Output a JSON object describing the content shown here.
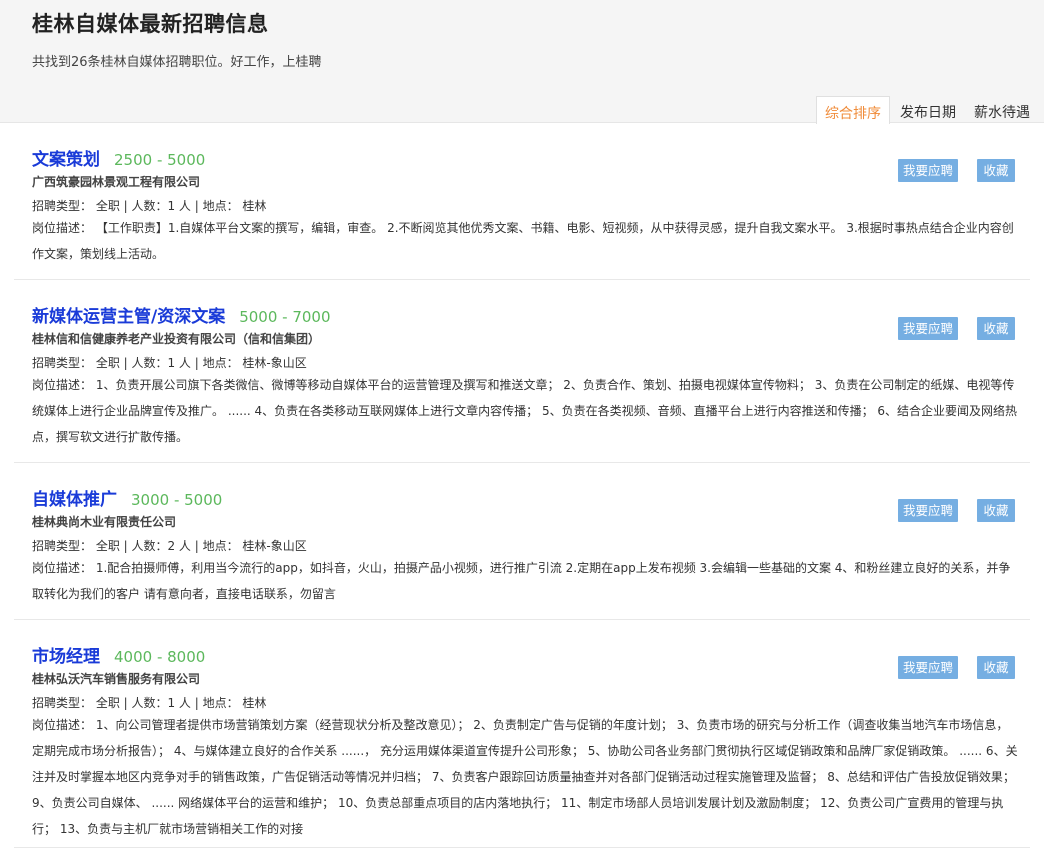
{
  "page": {
    "title": "桂林自媒体最新招聘信息",
    "summary": "共找到26条桂林自媒体招聘职位。好工作，上桂聘"
  },
  "sort_tabs": [
    {
      "label": "综合排序",
      "active": true
    },
    {
      "label": "发布日期",
      "active": false
    },
    {
      "label": "薪水待遇",
      "active": false
    }
  ],
  "buttons": {
    "apply": "我要应聘",
    "favorite": "收藏"
  },
  "jobs": [
    {
      "title": "文案策划",
      "salary": "2500 - 5000",
      "company": "广西筑豪园林景观工程有限公司",
      "meta": "招聘类型：  全职 | 人数：1 人 | 地点：  桂林",
      "description": "岗位描述：  【工作职责】1.自媒体平台文案的撰写，编辑，审查。 2.不断阅览其他优秀文案、书籍、电影、短视频，从中获得灵感，提升自我文案水平。 3.根据时事热点结合企业内容创作文案，策划线上活动。"
    },
    {
      "title": "新媒体运营主管/资深文案",
      "salary": "5000 - 7000",
      "company": "桂林信和信健康养老产业投资有限公司（信和信集团）",
      "meta": "招聘类型：  全职 | 人数：1 人 | 地点：  桂林-象山区",
      "description": "岗位描述：  1、负责开展公司旗下各类微信、微博等移动自媒体平台的运营管理及撰写和推送文章； 2、负责合作、策划、拍摄电视媒体宣传物料； 3、负责在公司制定的纸媒、电视等传统媒体上进行企业品牌宣传及推广。 ...... 4、负责在各类移动互联网媒体上进行文章内容传播； 5、负责在各类视频、音频、直播平台上进行内容推送和传播； 6、结合企业要闻及网络热点，撰写软文进行扩散传播。"
    },
    {
      "title": "自媒体推广",
      "salary": "3000 - 5000",
      "company": "桂林典尚木业有限责任公司",
      "meta": "招聘类型：  全职 | 人数：2 人 | 地点：  桂林-象山区",
      "description": "岗位描述：  1.配合拍摄师傅，利用当今流行的app，如抖音，火山，拍摄产品小视频，进行推广引流 2.定期在app上发布视频 3.会编辑一些基础的文案 4、和粉丝建立良好的关系，并争取转化为我们的客户 请有意向者，直接电话联系，勿留言"
    },
    {
      "title": "市场经理",
      "salary": "4000 - 8000",
      "company": "桂林弘沃汽车销售服务有限公司",
      "meta": "招聘类型：  全职 | 人数：1 人 | 地点：  桂林",
      "description": "岗位描述：  1、向公司管理者提供市场营销策划方案（经营现状分析及整改意见）； 2、负责制定广告与促销的年度计划； 3、负责市场的研究与分析工作（调查收集当地汽车市场信息，定期完成市场分析报告）； 4、与媒体建立良好的合作关系 ......， 充分运用媒体渠道宣传提升公司形象； 5、协助公司各业务部门贯彻执行区域促销政策和品牌厂家促销政策。 ...... 6、关注并及时掌握本地区内竞争对手的销售政策，广告促销活动等情况并归档； 7、负责客户跟踪回访质量抽查并对各部门促销活动过程实施管理及监督； 8、总结和评估广告投放促销效果； 9、负责公司自媒体、 ...... 网络媒体平台的运营和维护； 10、负责总部重点项目的店内落地执行； 11、制定市场部人员培训发展计划及激励制度； 12、负责公司广宣费用的管理与执行； 13、负责与主机厂就市场营销相关工作的对接"
    }
  ]
}
